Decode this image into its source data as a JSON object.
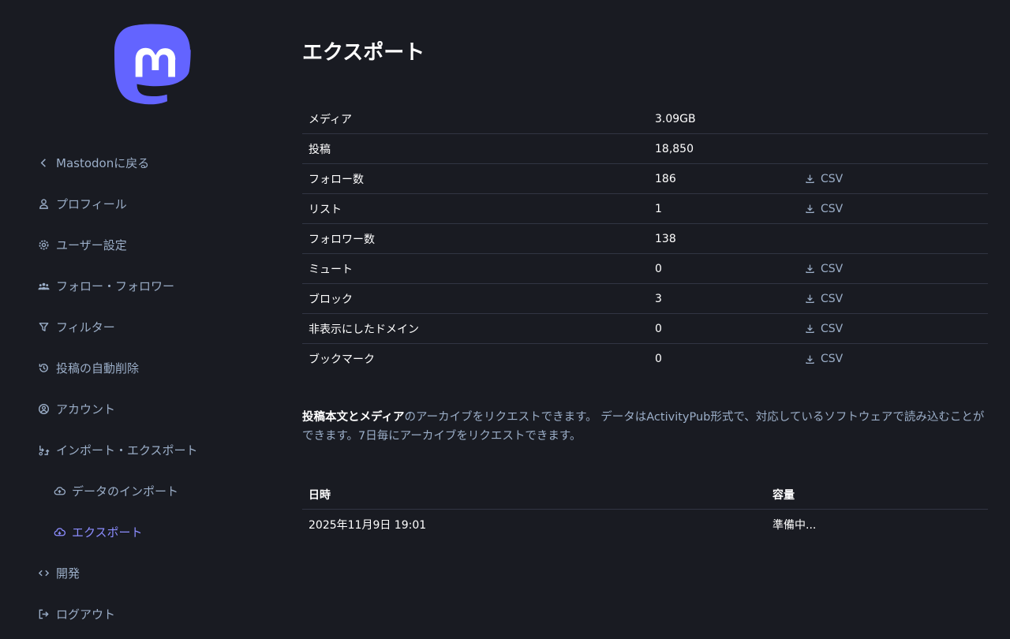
{
  "colors": {
    "background": "#191b22",
    "nav_text": "#9baec8",
    "nav_active": "#8c8dff",
    "divider": "#313543",
    "logo": "#6364ff"
  },
  "sidebar": {
    "logo_icon": "mastodon-logo",
    "items": [
      {
        "label": "Mastodonに戻る",
        "icon": "chevron-left-icon"
      },
      {
        "label": "プロフィール",
        "icon": "person-icon"
      },
      {
        "label": "ユーザー設定",
        "icon": "gear-icon"
      },
      {
        "label": "フォロー・フォロワー",
        "icon": "people-icon"
      },
      {
        "label": "フィルター",
        "icon": "filter-icon"
      },
      {
        "label": "投稿の自動削除",
        "icon": "history-icon"
      },
      {
        "label": "アカウント",
        "icon": "account-circle-icon"
      },
      {
        "label": "インポート・エクスポート",
        "icon": "import-export-icon"
      },
      {
        "label": "データのインポート",
        "icon": "cloud-upload-icon"
      },
      {
        "label": "エクスポート",
        "icon": "cloud-download-icon"
      },
      {
        "label": "開発",
        "icon": "code-icon"
      },
      {
        "label": "ログアウト",
        "icon": "logout-icon"
      }
    ]
  },
  "main": {
    "title": "エクスポート",
    "csv_label": "CSV",
    "stats": [
      {
        "label": "メディア",
        "value": "3.09GB",
        "csv": false
      },
      {
        "label": "投稿",
        "value": "18,850",
        "csv": false
      },
      {
        "label": "フォロー数",
        "value": "186",
        "csv": true
      },
      {
        "label": "リスト",
        "value": "1",
        "csv": true
      },
      {
        "label": "フォロワー数",
        "value": "138",
        "csv": false
      },
      {
        "label": "ミュート",
        "value": "0",
        "csv": true
      },
      {
        "label": "ブロック",
        "value": "3",
        "csv": true
      },
      {
        "label": "非表示にしたドメイン",
        "value": "0",
        "csv": true
      },
      {
        "label": "ブックマーク",
        "value": "0",
        "csv": true
      }
    ],
    "archive_note_bold": "投稿本文とメディア",
    "archive_note_rest": "のアーカイブをリクエストできます。 データはActivityPub形式で、対応しているソフトウェアで読み込むことができます。7日毎にアーカイブをリクエストできます。",
    "archive_table": {
      "headers": [
        "日時",
        "容量"
      ],
      "rows": [
        [
          "2025年11月9日 19:01",
          "準備中..."
        ]
      ]
    }
  }
}
